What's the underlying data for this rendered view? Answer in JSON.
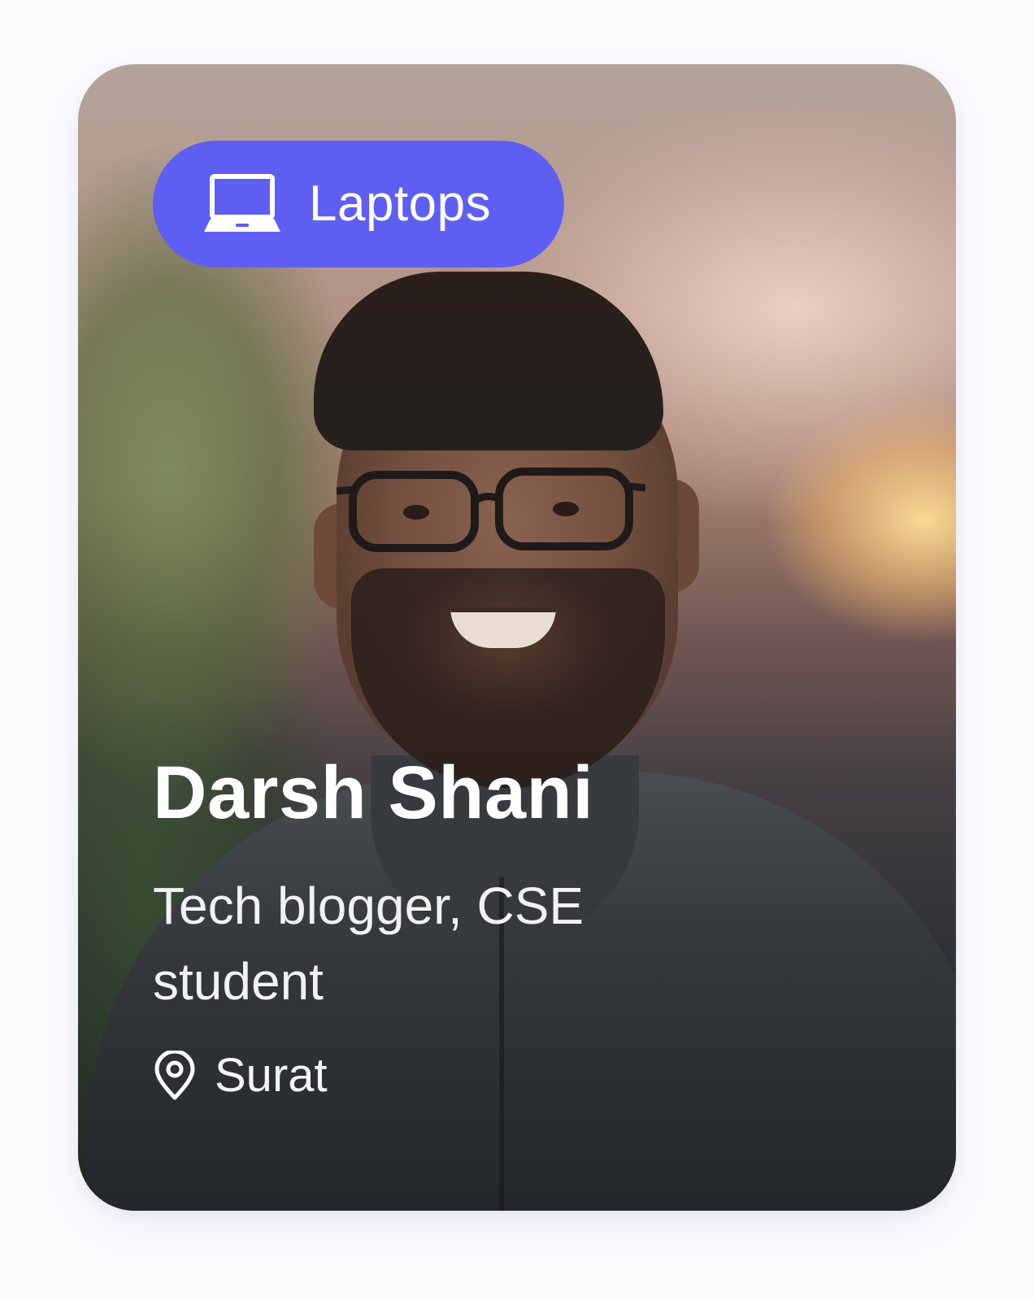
{
  "card": {
    "category": {
      "label": "Laptops",
      "icon": "laptop-icon",
      "color": "#5e5ff2"
    },
    "profile": {
      "name": "Darsh Shani",
      "bio": "Tech blogger, CSE student",
      "location": "Surat",
      "location_icon": "map-pin-icon"
    }
  }
}
